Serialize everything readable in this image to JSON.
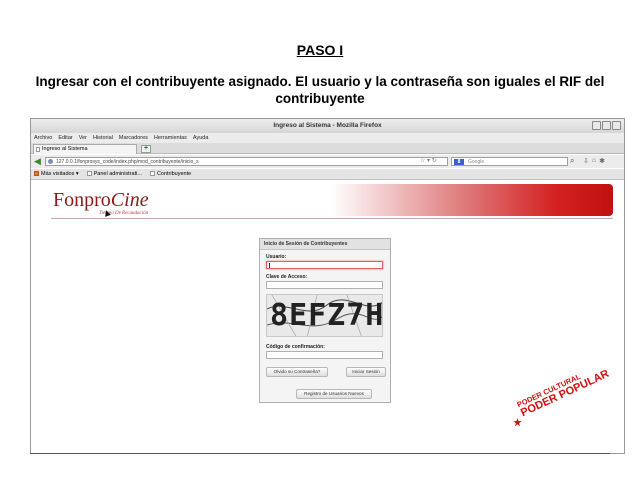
{
  "doc": {
    "heading": "PASO I",
    "instruction": "Ingresar con el contribuyente asignado. El usuario y la contraseña son iguales el RIF del contribuyente"
  },
  "browser": {
    "window_title": "Ingreso al Sistema - Mozilla Firefox",
    "menu": [
      "Archivo",
      "Editar",
      "Ver",
      "Historial",
      "Marcadores",
      "Herramientas",
      "Ayuda"
    ],
    "tab_label": "Ingreso al Sistema",
    "url": "127.0.0.1/fonprosys_code/index.php/mod_contribuyente/inicio_s",
    "search_placeholder": "Google",
    "bookmarks": [
      "Más visitados",
      "Panel administrati...",
      "Contribuyente"
    ]
  },
  "site": {
    "logo_main": "Fonpro",
    "logo_cine": "Cine",
    "tagline": "Tiempo De Recaudación"
  },
  "login": {
    "panel_title": "Inicio de Sesión de Contribuyentes",
    "user_label": "Usuario:",
    "pass_label": "Clave de Acceso:",
    "captcha_text": "8EFZ7H",
    "code_label": "Código de confirmación:",
    "forgot_button": "Olvido su Contraseña?",
    "login_button": "Iniciar Sesión",
    "register_button": "Registro de Usuarios Nuevos"
  },
  "footer": {
    "poder_line1": "PODER CULTURAL",
    "poder_line2": "PODER POPULAR"
  },
  "colors": {
    "brand_red": "#d01010",
    "logo_red": "#8a1a1a"
  }
}
